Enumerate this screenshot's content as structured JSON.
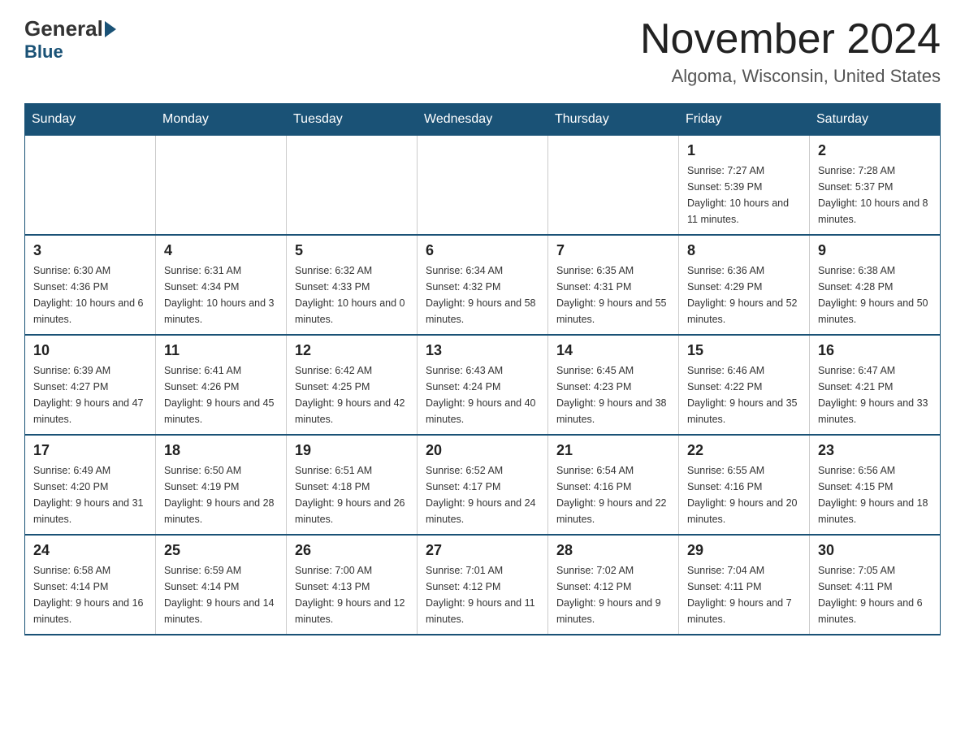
{
  "header": {
    "logo_general": "General",
    "logo_blue": "Blue",
    "month_title": "November 2024",
    "location": "Algoma, Wisconsin, United States"
  },
  "days_of_week": [
    "Sunday",
    "Monday",
    "Tuesday",
    "Wednesday",
    "Thursday",
    "Friday",
    "Saturday"
  ],
  "weeks": [
    [
      {
        "day": "",
        "info": ""
      },
      {
        "day": "",
        "info": ""
      },
      {
        "day": "",
        "info": ""
      },
      {
        "day": "",
        "info": ""
      },
      {
        "day": "",
        "info": ""
      },
      {
        "day": "1",
        "info": "Sunrise: 7:27 AM\nSunset: 5:39 PM\nDaylight: 10 hours and 11 minutes."
      },
      {
        "day": "2",
        "info": "Sunrise: 7:28 AM\nSunset: 5:37 PM\nDaylight: 10 hours and 8 minutes."
      }
    ],
    [
      {
        "day": "3",
        "info": "Sunrise: 6:30 AM\nSunset: 4:36 PM\nDaylight: 10 hours and 6 minutes."
      },
      {
        "day": "4",
        "info": "Sunrise: 6:31 AM\nSunset: 4:34 PM\nDaylight: 10 hours and 3 minutes."
      },
      {
        "day": "5",
        "info": "Sunrise: 6:32 AM\nSunset: 4:33 PM\nDaylight: 10 hours and 0 minutes."
      },
      {
        "day": "6",
        "info": "Sunrise: 6:34 AM\nSunset: 4:32 PM\nDaylight: 9 hours and 58 minutes."
      },
      {
        "day": "7",
        "info": "Sunrise: 6:35 AM\nSunset: 4:31 PM\nDaylight: 9 hours and 55 minutes."
      },
      {
        "day": "8",
        "info": "Sunrise: 6:36 AM\nSunset: 4:29 PM\nDaylight: 9 hours and 52 minutes."
      },
      {
        "day": "9",
        "info": "Sunrise: 6:38 AM\nSunset: 4:28 PM\nDaylight: 9 hours and 50 minutes."
      }
    ],
    [
      {
        "day": "10",
        "info": "Sunrise: 6:39 AM\nSunset: 4:27 PM\nDaylight: 9 hours and 47 minutes."
      },
      {
        "day": "11",
        "info": "Sunrise: 6:41 AM\nSunset: 4:26 PM\nDaylight: 9 hours and 45 minutes."
      },
      {
        "day": "12",
        "info": "Sunrise: 6:42 AM\nSunset: 4:25 PM\nDaylight: 9 hours and 42 minutes."
      },
      {
        "day": "13",
        "info": "Sunrise: 6:43 AM\nSunset: 4:24 PM\nDaylight: 9 hours and 40 minutes."
      },
      {
        "day": "14",
        "info": "Sunrise: 6:45 AM\nSunset: 4:23 PM\nDaylight: 9 hours and 38 minutes."
      },
      {
        "day": "15",
        "info": "Sunrise: 6:46 AM\nSunset: 4:22 PM\nDaylight: 9 hours and 35 minutes."
      },
      {
        "day": "16",
        "info": "Sunrise: 6:47 AM\nSunset: 4:21 PM\nDaylight: 9 hours and 33 minutes."
      }
    ],
    [
      {
        "day": "17",
        "info": "Sunrise: 6:49 AM\nSunset: 4:20 PM\nDaylight: 9 hours and 31 minutes."
      },
      {
        "day": "18",
        "info": "Sunrise: 6:50 AM\nSunset: 4:19 PM\nDaylight: 9 hours and 28 minutes."
      },
      {
        "day": "19",
        "info": "Sunrise: 6:51 AM\nSunset: 4:18 PM\nDaylight: 9 hours and 26 minutes."
      },
      {
        "day": "20",
        "info": "Sunrise: 6:52 AM\nSunset: 4:17 PM\nDaylight: 9 hours and 24 minutes."
      },
      {
        "day": "21",
        "info": "Sunrise: 6:54 AM\nSunset: 4:16 PM\nDaylight: 9 hours and 22 minutes."
      },
      {
        "day": "22",
        "info": "Sunrise: 6:55 AM\nSunset: 4:16 PM\nDaylight: 9 hours and 20 minutes."
      },
      {
        "day": "23",
        "info": "Sunrise: 6:56 AM\nSunset: 4:15 PM\nDaylight: 9 hours and 18 minutes."
      }
    ],
    [
      {
        "day": "24",
        "info": "Sunrise: 6:58 AM\nSunset: 4:14 PM\nDaylight: 9 hours and 16 minutes."
      },
      {
        "day": "25",
        "info": "Sunrise: 6:59 AM\nSunset: 4:14 PM\nDaylight: 9 hours and 14 minutes."
      },
      {
        "day": "26",
        "info": "Sunrise: 7:00 AM\nSunset: 4:13 PM\nDaylight: 9 hours and 12 minutes."
      },
      {
        "day": "27",
        "info": "Sunrise: 7:01 AM\nSunset: 4:12 PM\nDaylight: 9 hours and 11 minutes."
      },
      {
        "day": "28",
        "info": "Sunrise: 7:02 AM\nSunset: 4:12 PM\nDaylight: 9 hours and 9 minutes."
      },
      {
        "day": "29",
        "info": "Sunrise: 7:04 AM\nSunset: 4:11 PM\nDaylight: 9 hours and 7 minutes."
      },
      {
        "day": "30",
        "info": "Sunrise: 7:05 AM\nSunset: 4:11 PM\nDaylight: 9 hours and 6 minutes."
      }
    ]
  ]
}
